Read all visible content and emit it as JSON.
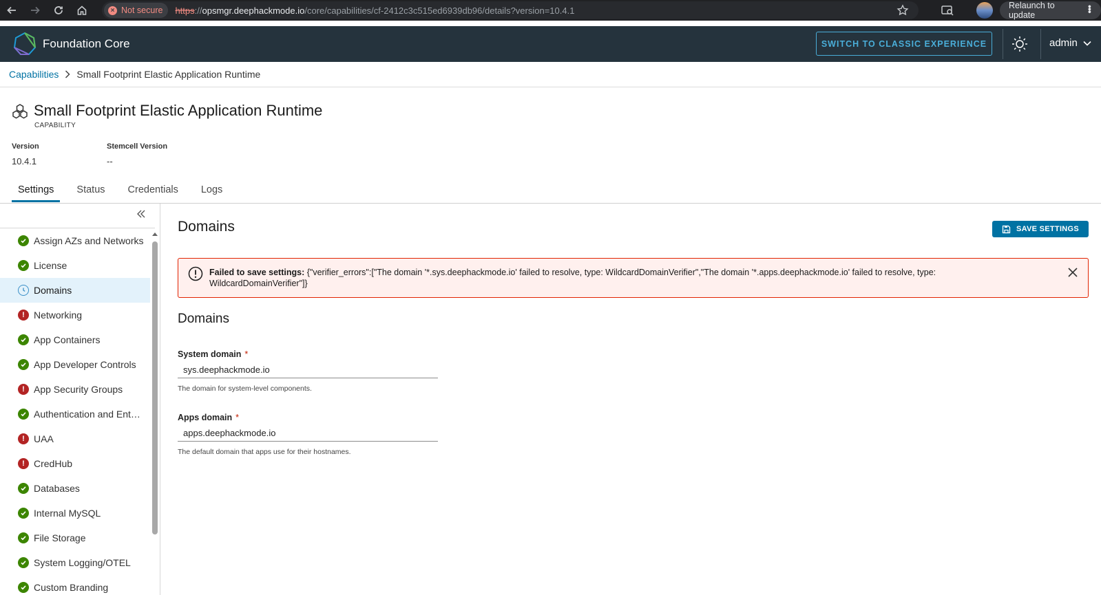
{
  "browser": {
    "security_label": "Not secure",
    "url_protocol": "https",
    "url_separator": "://",
    "url_host": "opsmgr.deephackmode.io",
    "url_path": "/core/capabilities/cf-2412c3c515ed6939db96/details?version=10.4.1",
    "relaunch_label": "Relaunch to update"
  },
  "header": {
    "app_title": "Foundation Core",
    "classic_button": "SWITCH TO CLASSIC EXPERIENCE",
    "user": "admin"
  },
  "breadcrumb": {
    "parent": "Capabilities",
    "current": "Small Footprint Elastic Application Runtime"
  },
  "capability": {
    "title": "Small Footprint Elastic Application Runtime",
    "subtitle": "CAPABILITY",
    "version_label": "Version",
    "version_value": "10.4.1",
    "stemcell_label": "Stemcell Version",
    "stemcell_value": "--"
  },
  "tabs": [
    {
      "label": "Settings",
      "active": true
    },
    {
      "label": "Status"
    },
    {
      "label": "Credentials"
    },
    {
      "label": "Logs"
    }
  ],
  "sidebar": {
    "items": [
      {
        "label": "Assign AZs and Networks",
        "status": "ok"
      },
      {
        "label": "License",
        "status": "ok"
      },
      {
        "label": "Domains",
        "status": "in-progress"
      },
      {
        "label": "Networking",
        "status": "error"
      },
      {
        "label": "App Containers",
        "status": "ok"
      },
      {
        "label": "App Developer Controls",
        "status": "ok"
      },
      {
        "label": "App Security Groups",
        "status": "error"
      },
      {
        "label": "Authentication and Enterprise SSO",
        "status": "ok"
      },
      {
        "label": "UAA",
        "status": "error"
      },
      {
        "label": "CredHub",
        "status": "error"
      },
      {
        "label": "Databases",
        "status": "ok"
      },
      {
        "label": "Internal MySQL",
        "status": "ok"
      },
      {
        "label": "File Storage",
        "status": "ok"
      },
      {
        "label": "System Logging/OTEL",
        "status": "ok"
      },
      {
        "label": "Custom Branding",
        "status": "ok"
      }
    ]
  },
  "main": {
    "title": "Domains",
    "save_button": "SAVE SETTINGS",
    "alert_strong": "Failed to save settings:",
    "alert_message": "{\"verifier_errors\":[\"The domain '*.sys.deephackmode.io' failed to resolve, type: WildcardDomainVerifier\",\"The domain '*.apps.deephackmode.io' failed to resolve, type: WildcardDomainVerifier\"]}",
    "section_title": "Domains",
    "fields": [
      {
        "label": "System domain",
        "required_mark": "*",
        "value": "sys.deephackmode.io",
        "help": "The domain for system-level components."
      },
      {
        "label": "Apps domain",
        "required_mark": "*",
        "value": "apps.deephackmode.io",
        "help": "The default domain that apps use for their hostnames."
      }
    ]
  },
  "colors": {
    "header_bg": "#25333d",
    "accent": "#0072a3",
    "status_ok": "#3c8500",
    "status_error": "#b32424",
    "alert_border": "#e12200"
  }
}
